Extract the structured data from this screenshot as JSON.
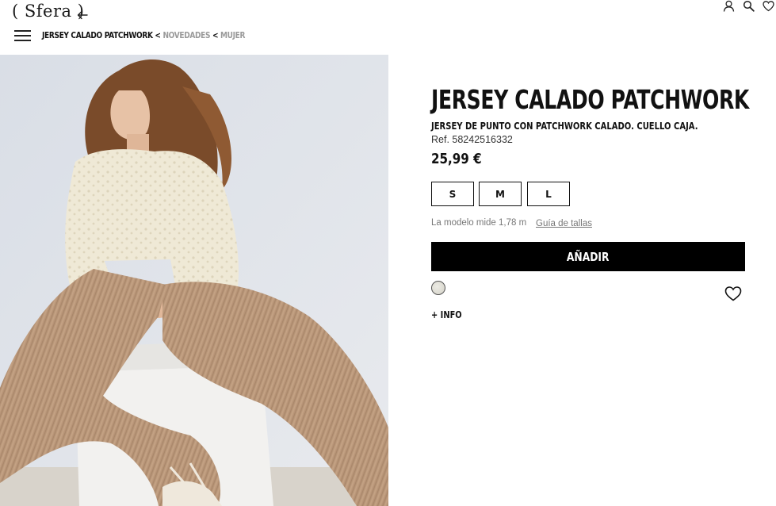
{
  "header": {
    "logo": "( Sfera )",
    "breadcrumb": {
      "current": "JERSEY CALADO PATCHWORK",
      "separator": "<",
      "items": [
        "NOVEDADES",
        "MUJER"
      ]
    },
    "icons": [
      "user-icon",
      "search-icon",
      "heart-icon"
    ]
  },
  "product": {
    "title": "JERSEY CALADO PATCHWORK",
    "subtitle": "JERSEY DE PUNTO CON PATCHWORK CALADO. CUELLO CAJA.",
    "ref": "Ref. 58242516332",
    "price": "25,99 €",
    "sizes": [
      "S",
      "M",
      "L"
    ],
    "model_note": "La modelo mide 1,78 m",
    "size_guide": "Guía de tallas",
    "add_button": "AÑADIR",
    "info_link": "+ INFO",
    "swatch_color": "#e4e2da"
  },
  "colors": {
    "primary": "#000000",
    "muted_text": "#777777",
    "breadcrumb_link": "#9a9a9a"
  }
}
